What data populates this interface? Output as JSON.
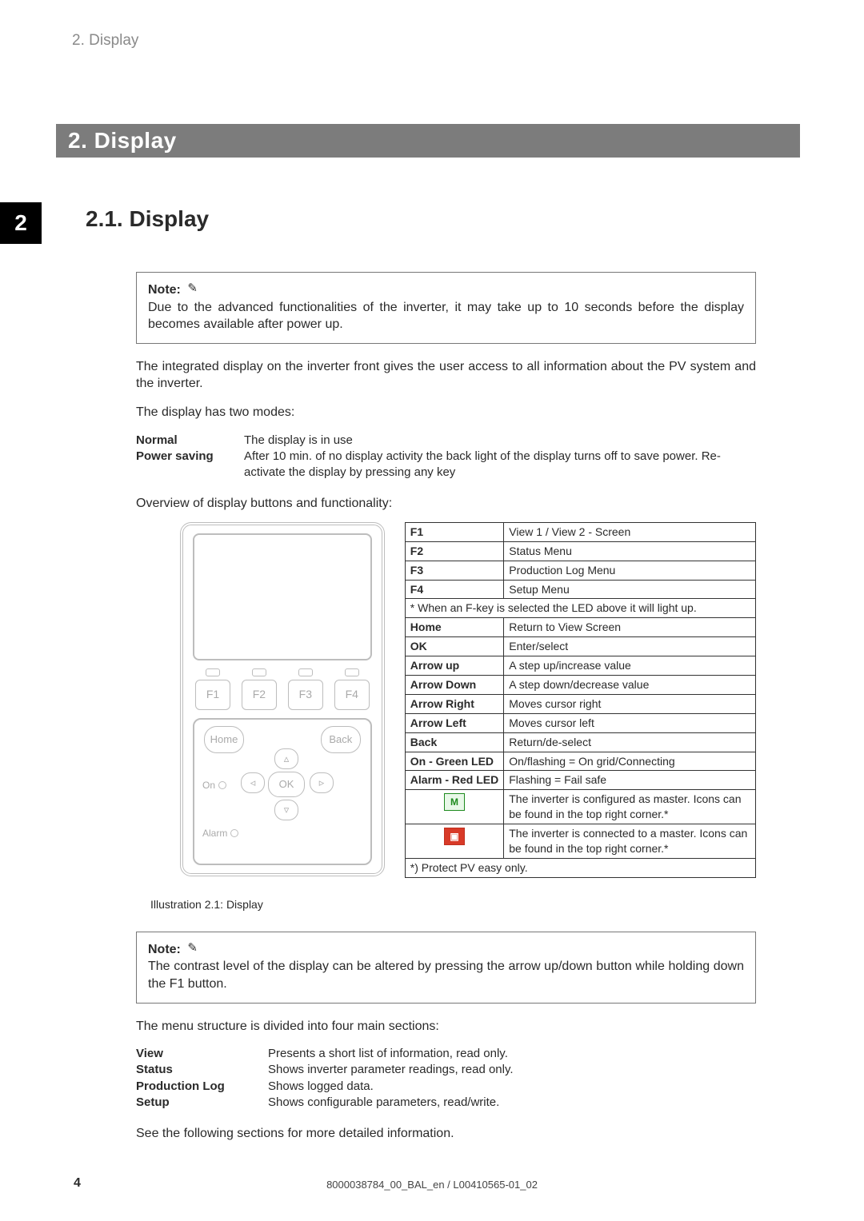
{
  "header": {
    "breadcrumb": "2. Display"
  },
  "chapter": {
    "bar_title": "2.  Display",
    "section_number": "2",
    "section_title": "2.1.  Display"
  },
  "note1": {
    "prefix": "Note:",
    "text": "Due to the advanced functionalities of the inverter, it may take up to 10 seconds before the display becomes available after power up."
  },
  "body": {
    "para1": "The integrated display on the inverter front gives the user access to all information about the PV system and the inverter.",
    "para2": "The display has two modes:",
    "modes": [
      {
        "label": "Normal",
        "desc": "The display is in use"
      },
      {
        "label": "Power saving",
        "desc": "After 10 min. of no display activity the back light of the display turns off to save power. Re-activate the display by pressing any key"
      }
    ],
    "overview": "Overview of display buttons and functionality:"
  },
  "diagram": {
    "fkeys": [
      "F1",
      "F2",
      "F3",
      "F4"
    ],
    "home": "Home",
    "back": "Back",
    "ok": "OK",
    "on": "On",
    "alarm": "Alarm"
  },
  "func_table": {
    "rows": [
      {
        "k": "F1",
        "v": "View 1 / View 2 - Screen"
      },
      {
        "k": "F2",
        "v": "Status Menu"
      },
      {
        "k": "F3",
        "v": "Production Log Menu"
      },
      {
        "k": "F4",
        "v": "Setup Menu"
      }
    ],
    "span1": "* When an F-key is selected the LED above it will light up.",
    "rows2": [
      {
        "k": "Home",
        "v": "Return to View Screen"
      },
      {
        "k": "OK",
        "v": "Enter/select"
      },
      {
        "k": "Arrow up",
        "v": "A step up/increase value"
      },
      {
        "k": "Arrow Down",
        "v": "A step down/decrease value"
      },
      {
        "k": "Arrow Right",
        "v": "Moves cursor right"
      },
      {
        "k": "Arrow Left",
        "v": "Moves cursor left"
      },
      {
        "k": "Back",
        "v": "Return/de-select"
      },
      {
        "k": "On - Green LED",
        "v": "On/flashing = On grid/Connecting"
      },
      {
        "k": "Alarm - Red LED",
        "v": "Flashing = Fail safe"
      }
    ],
    "iconM": "M",
    "iconM_desc": "The inverter is configured as master. Icons can be found in the top right corner.*",
    "iconC": "⬚",
    "iconC_desc": "The inverter is connected to a master. Icons can be found in the top right corner.*",
    "footnote": "*) Protect PV easy only."
  },
  "illustration_caption": "Illustration 2.1: Display",
  "note2": {
    "prefix": "Note:",
    "text": "The contrast level of the display can be altered by pressing the arrow up/down button while holding down the F1 button."
  },
  "menu_intro": "The menu structure is divided into four main sections:",
  "menu_sections": [
    {
      "k": "View",
      "v": "Presents a short list of information, read only."
    },
    {
      "k": "Status",
      "v": "Shows inverter parameter readings, read only."
    },
    {
      "k": "Production Log",
      "v": "Shows logged data."
    },
    {
      "k": "Setup",
      "v": "Shows configurable parameters, read/write."
    }
  ],
  "closing": "See the following sections for more detailed information.",
  "footer": {
    "page": "4",
    "doc": "8000038784_00_BAL_en / L00410565-01_02"
  }
}
